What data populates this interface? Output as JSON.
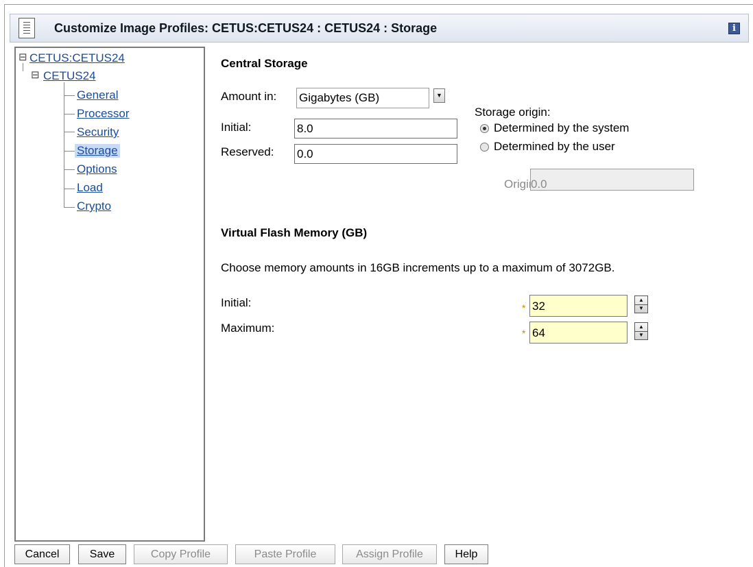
{
  "window": {
    "title": "Customize Image Profiles: CETUS:CETUS24 : CETUS24 : Storage"
  },
  "icons": {
    "title": "page-icon",
    "info": "info-icon"
  },
  "nav": {
    "root": "CETUS:CETUS24",
    "image": "CETUS24",
    "items": [
      {
        "label": "General"
      },
      {
        "label": "Processor"
      },
      {
        "label": "Security"
      },
      {
        "label": "Storage",
        "selected": true
      },
      {
        "label": "Options"
      },
      {
        "label": "Load"
      },
      {
        "label": "Crypto"
      }
    ]
  },
  "central_storage": {
    "heading": "Central Storage",
    "amount_label": "Amount in:",
    "amount_value": "Gigabytes (GB)",
    "initial_label": "Initial:",
    "initial_value": "8.0",
    "reserved_label": "Reserved:",
    "reserved_value": "0.0",
    "origin_heading": "Storage origin:",
    "origin_options": [
      {
        "label": "Determined by the system",
        "selected": true
      },
      {
        "label": "Determined by the user",
        "selected": false
      }
    ],
    "origin_label": "Origin:",
    "origin_value": "0.0"
  },
  "vfm": {
    "heading": "Virtual Flash Memory (GB)",
    "description": "Choose memory amounts in 16GB increments up to a maximum of 3072GB.",
    "initial_label": "Initial:",
    "initial_value": "32",
    "maximum_label": "Maximum:",
    "maximum_value": "64",
    "required_mark": "*"
  },
  "buttons": {
    "cancel": "Cancel",
    "save": "Save",
    "copy": "Copy Profile",
    "paste": "Paste Profile",
    "assign": "Assign Profile",
    "help": "Help"
  },
  "colors": {
    "link": "#1a4c9c",
    "selected_bg": "#c8daf5",
    "required_field": "#ffffcc"
  }
}
